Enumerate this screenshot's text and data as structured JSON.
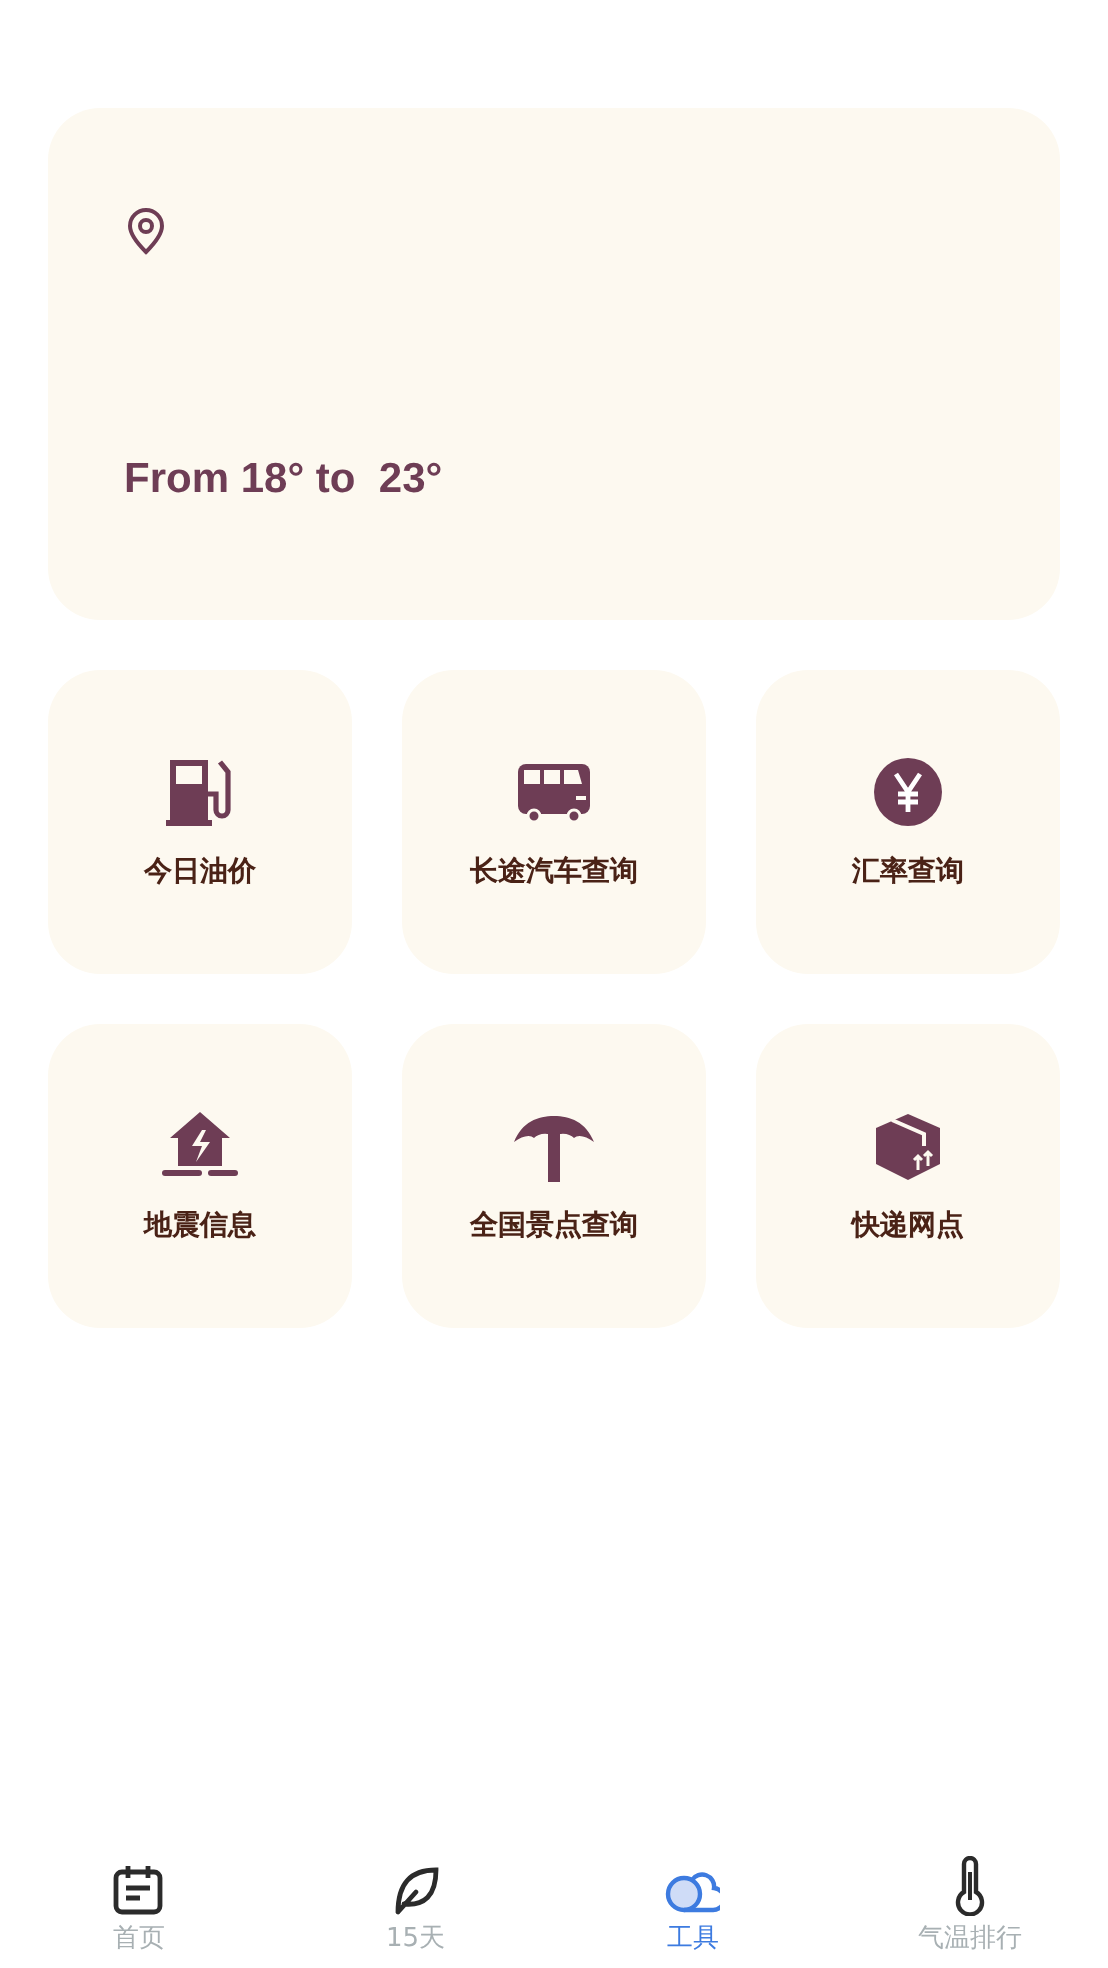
{
  "weather_card": {
    "temperature_range": "From 18° to  23°"
  },
  "tools": [
    {
      "label": "今日油价",
      "kind": "fuel"
    },
    {
      "label": "长途汽车查询",
      "kind": "bus"
    },
    {
      "label": "汇率查询",
      "kind": "yuan"
    },
    {
      "label": "地震信息",
      "kind": "earthquake"
    },
    {
      "label": "全国景点查询",
      "kind": "palm"
    },
    {
      "label": "快递网点",
      "kind": "package"
    }
  ],
  "bottom_nav": [
    {
      "label": "首页",
      "kind": "calendar",
      "selected": false
    },
    {
      "label": "15天",
      "kind": "leaf",
      "selected": false
    },
    {
      "label": "工具",
      "kind": "cloud",
      "selected": true
    },
    {
      "label": "气温排行",
      "kind": "thermometer",
      "selected": false
    }
  ]
}
